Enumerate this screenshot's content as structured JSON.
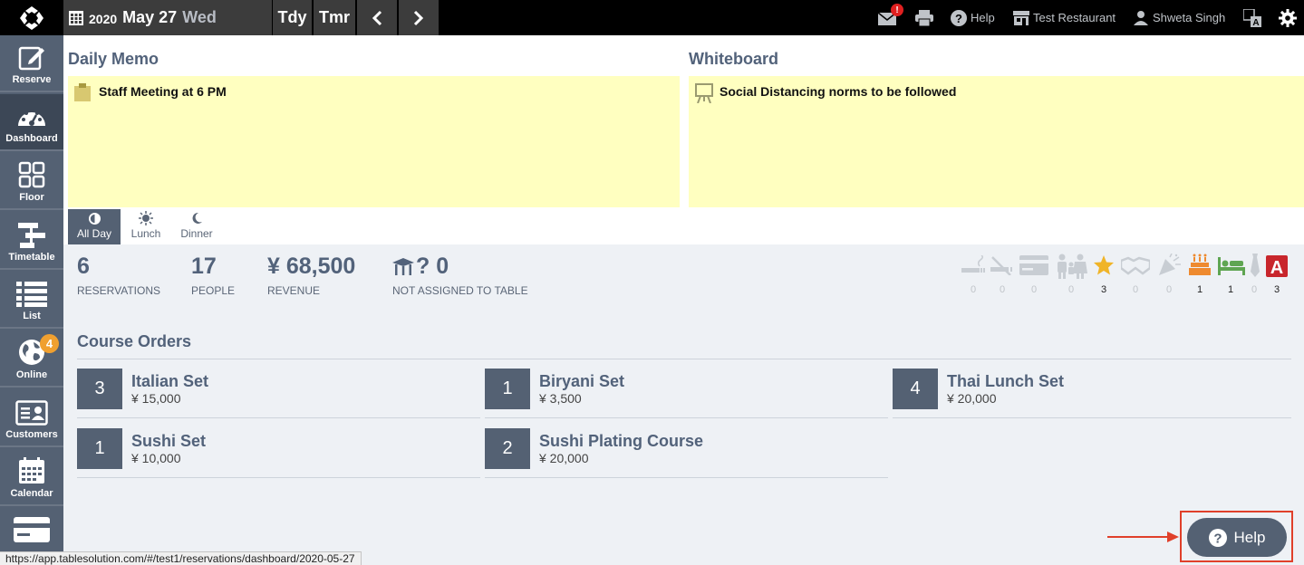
{
  "topbar": {
    "year": "2020",
    "month_day": "May 27",
    "weekday": "Wed",
    "today_label": "Tdy",
    "tomorrow_label": "Tmr",
    "mail_alert": "!",
    "help_label": "Help",
    "restaurant_label": "Test Restaurant",
    "user_label": "Shweta Singh"
  },
  "sidebar": {
    "items": [
      {
        "label": "Reserve",
        "icon": "edit-icon"
      },
      {
        "label": "Dashboard",
        "icon": "gauge-icon"
      },
      {
        "label": "Floor",
        "icon": "floor-grid-icon"
      },
      {
        "label": "Timetable",
        "icon": "timetable-icon"
      },
      {
        "label": "List",
        "icon": "list-icon"
      },
      {
        "label": "Online",
        "icon": "globe-icon",
        "badge": "4"
      },
      {
        "label": "Customers",
        "icon": "customer-card-icon"
      },
      {
        "label": "Calendar",
        "icon": "calendar-icon"
      },
      {
        "label": "",
        "icon": "credit-card-icon"
      }
    ]
  },
  "memo": {
    "daily_title": "Daily Memo",
    "daily_text": "Staff Meeting at 6 PM",
    "whiteboard_title": "Whiteboard",
    "whiteboard_text": "Social Distancing norms to be followed"
  },
  "tabs": [
    {
      "label": "All Day",
      "icon": "half-circle-icon",
      "active": true
    },
    {
      "label": "Lunch",
      "icon": "sun-icon",
      "active": false
    },
    {
      "label": "Dinner",
      "icon": "moon-icon",
      "active": false
    }
  ],
  "stats": {
    "reservations": {
      "value": "6",
      "label": "RESERVATIONS"
    },
    "people": {
      "value": "17",
      "label": "PEOPLE"
    },
    "revenue": {
      "value": "¥ 68,500",
      "label": "REVENUE"
    },
    "unassigned": {
      "value": "? 0",
      "label": "NOT ASSIGNED TO TABLE"
    }
  },
  "attributes": [
    {
      "icon": "smoking-icon",
      "count": "0",
      "color": "#c8cdd3"
    },
    {
      "icon": "no-smoking-icon",
      "count": "0",
      "color": "#c8cdd3"
    },
    {
      "icon": "credit-card-icon",
      "count": "0",
      "color": "#c8cdd3"
    },
    {
      "icon": "family-icon",
      "count": "0",
      "color": "#c8cdd3"
    },
    {
      "icon": "star-icon",
      "count": "3",
      "color": "#f0b428"
    },
    {
      "icon": "handshake-icon",
      "count": "0",
      "color": "#c8cdd3"
    },
    {
      "icon": "party-icon",
      "count": "0",
      "color": "#c8cdd3"
    },
    {
      "icon": "cake-icon",
      "count": "1",
      "color": "#ee8a2f"
    },
    {
      "icon": "bed-icon",
      "count": "1",
      "color": "#5fa552"
    },
    {
      "icon": "tie-icon",
      "count": "0",
      "color": "#c8cdd3"
    },
    {
      "icon": "allergy-a-icon",
      "count": "3",
      "color": "#c8262c"
    }
  ],
  "course_orders": {
    "title": "Course Orders",
    "items": [
      {
        "qty": "3",
        "name": "Italian Set",
        "price": "¥ 15,000"
      },
      {
        "qty": "1",
        "name": "Biryani Set",
        "price": "¥ 3,500"
      },
      {
        "qty": "4",
        "name": "Thai Lunch Set",
        "price": "¥ 20,000"
      },
      {
        "qty": "1",
        "name": "Sushi Set",
        "price": "¥ 10,000"
      },
      {
        "qty": "2",
        "name": "Sushi Plating Course",
        "price": "¥ 20,000"
      }
    ]
  },
  "help_button": {
    "label": "Help"
  },
  "status_bar": {
    "url": "https://app.tablesolution.com/#/test1/reservations/dashboard/2020-05-27"
  }
}
